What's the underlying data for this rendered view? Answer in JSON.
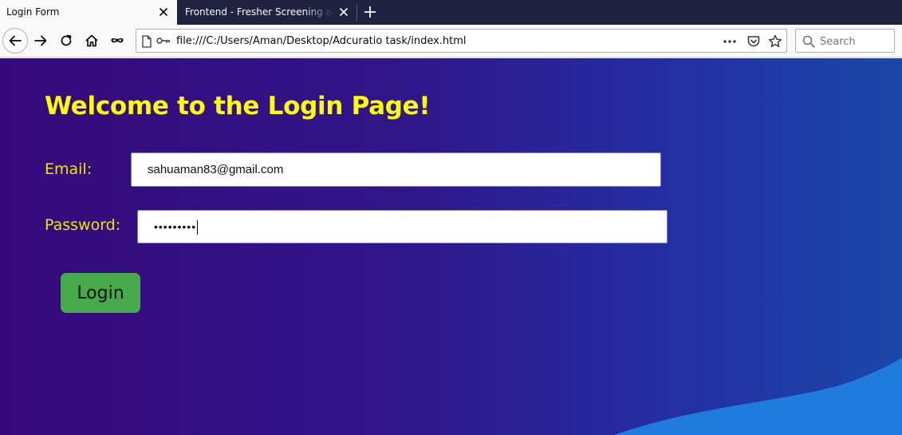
{
  "browser": {
    "tabs": [
      {
        "title": "Login Form",
        "active": true
      },
      {
        "title": "Frontend - Fresher Screening assignment",
        "active": false
      }
    ],
    "url": "file:///C:/Users/Aman/Desktop/Adcuratio task/index.html",
    "search_placeholder": "Search",
    "icons": {
      "back": "back-arrow-icon",
      "forward": "forward-arrow-icon",
      "reload": "reload-icon",
      "home": "home-icon",
      "private": "mask-icon",
      "page": "page-icon",
      "key": "key-icon",
      "page_actions": "more-dots-icon",
      "pocket": "pocket-icon",
      "bookmark": "star-icon",
      "search": "search-icon",
      "close_tab": "close-icon",
      "new_tab": "plus-icon"
    }
  },
  "page": {
    "heading": "Welcome to the Login Page!",
    "email_label": "Email:",
    "email_value": "sahuaman83@gmail.com",
    "password_label": "Password:",
    "password_value": "•••••••••",
    "login_label": "Login",
    "colors": {
      "heading": "#fefe00",
      "background_start": "#36097a",
      "background_end": "#1a47a9",
      "wave": "#1f7bdc",
      "button": "#46a94a"
    }
  }
}
